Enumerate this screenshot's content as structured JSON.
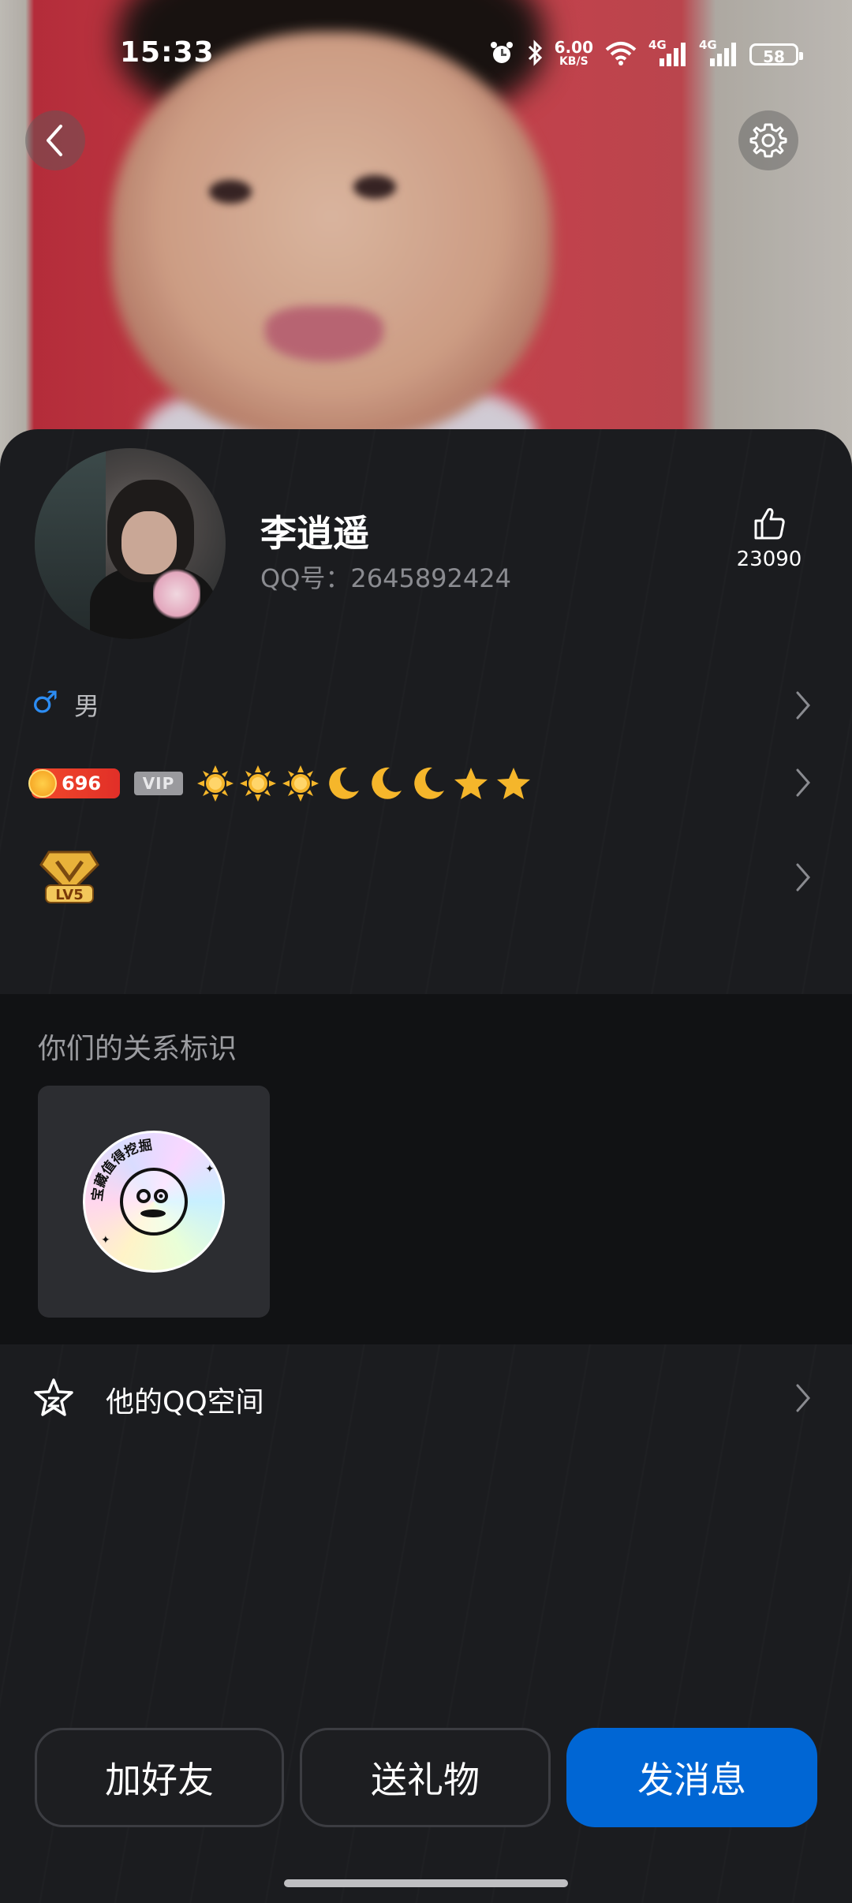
{
  "status_bar": {
    "time": "15:33",
    "net_speed": "6.00",
    "net_unit": "KB/S",
    "signal1": "4G",
    "signal2": "4G",
    "battery": "58",
    "icons": [
      "alarm-icon",
      "bluetooth-icon",
      "wifi-icon",
      "signal-icon",
      "signal-icon",
      "battery-icon"
    ]
  },
  "header": {
    "back_icon": "chevron-left-icon",
    "settings_icon": "gear-icon"
  },
  "profile": {
    "nickname": "李逍遥",
    "qq_number": "QQ号：2645892424",
    "likes": "23090",
    "like_icon": "thumbs-up-icon"
  },
  "info_rows": {
    "gender_symbol": "♂",
    "gender": "男",
    "level_badge": "696",
    "vip_label": "VIP",
    "level_icons": [
      "sun",
      "sun",
      "sun",
      "moon",
      "moon",
      "moon",
      "star",
      "star"
    ],
    "svip_badge": "LV5"
  },
  "relation": {
    "title": "你们的关系标识",
    "sticker_text": "宝藏值得挖掘"
  },
  "qzone": {
    "label": "他的QQ空间",
    "icon": "star-outline-icon"
  },
  "actions": {
    "add_friend": "加好友",
    "send_gift": "送礼物",
    "send_message": "发消息"
  },
  "colors": {
    "primary_button": "#0066d4",
    "gender_male": "#2c8cf2",
    "background": "#1b1c1f"
  }
}
